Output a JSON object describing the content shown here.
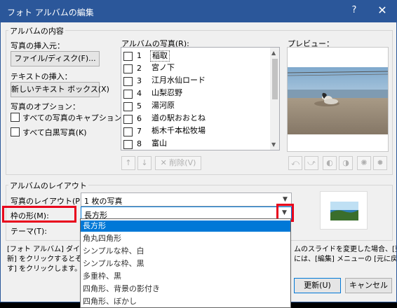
{
  "window": {
    "title": "フォト アルバムの編集",
    "help": "?",
    "close": "✕"
  },
  "album_content": {
    "group_label": "アルバムの内容",
    "insert_photo_label": "写真の挿入元：",
    "file_disk_button": "ファイル/ディスク(F)...",
    "insert_text_label": "テキストの挿入：",
    "new_textbox_button": "新しいテキスト ボックス(X)",
    "photo_options_label": "写真のオプション：",
    "caption_all_label": "すべての写真のキャプション(A)",
    "caption_all_checked": false,
    "bw_all_label": "すべて白黒写真(K)",
    "bw_all_checked": false
  },
  "photos": {
    "label": "アルバムの写真(R):",
    "items": [
      {
        "num": "1",
        "name": "稲取",
        "selected": true
      },
      {
        "num": "2",
        "name": "宮ノ下",
        "selected": false
      },
      {
        "num": "3",
        "name": "江月水仙ロード",
        "selected": false
      },
      {
        "num": "4",
        "name": "山梨忍野",
        "selected": false
      },
      {
        "num": "5",
        "name": "湯河原",
        "selected": false
      },
      {
        "num": "6",
        "name": "道の駅おおとね",
        "selected": false
      },
      {
        "num": "7",
        "name": "栃木千本松牧場",
        "selected": false
      },
      {
        "num": "8",
        "name": "富山",
        "selected": false
      }
    ],
    "up_arrow": "↑",
    "down_arrow": "↓",
    "delete_button": "✕ 削除(V)"
  },
  "preview": {
    "label": "プレビュー："
  },
  "layout": {
    "group_label": "アルバムのレイアウト",
    "photo_layout_label": "写真のレイアウト(P):",
    "photo_layout_value": "1 枚の写真",
    "frame_shape_label": "枠の形(M):",
    "frame_shape_value": "長方形",
    "theme_label": "テーマ(T):",
    "frame_options": [
      "長方形",
      "角丸四角形",
      "シンプルな枠、白",
      "シンプルな枠、黒",
      "多重枠、黒",
      "四角形、背景の影付き",
      "四角形、ぼかし"
    ],
    "frame_selected_index": 0
  },
  "notes": {
    "left_line1": "[フォト アルバム] ダイアロ",
    "left_line2": "新] をクリックするとその変",
    "left_line3": "す] をクリックします。",
    "right_line1": "ムのスライドを変更した場合、[更",
    "right_line2": "には、[編集] メニューの [元に戻"
  },
  "footer": {
    "update_button": "更新(U)",
    "cancel_button": "キャンセル"
  },
  "colors": {
    "titlebar": "#2b579a",
    "highlight": "#0078d7",
    "callout": "#e8001c"
  }
}
